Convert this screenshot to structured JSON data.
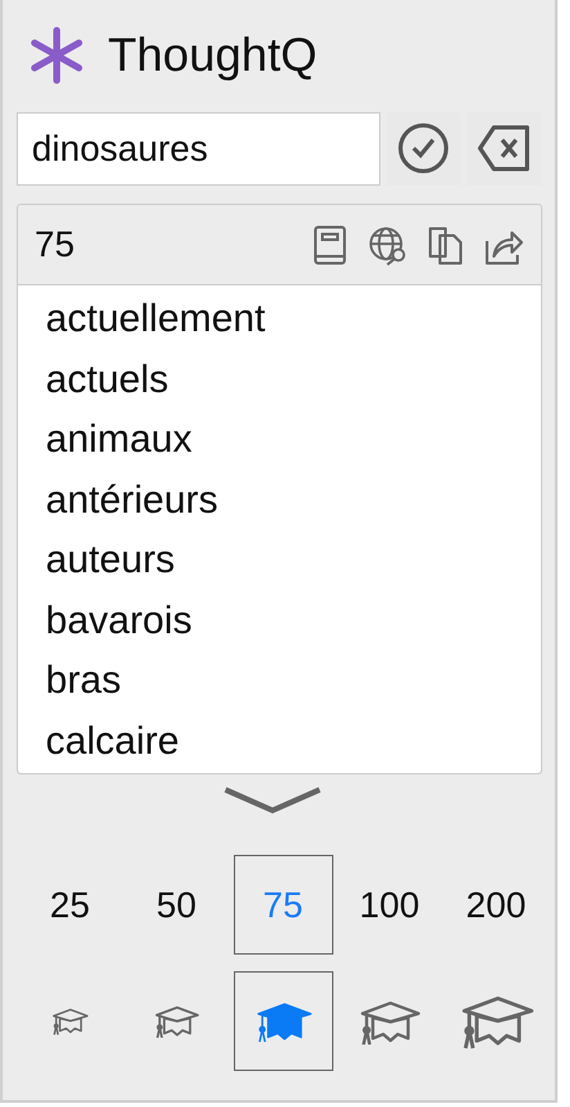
{
  "app": {
    "title": "ThoughtQ"
  },
  "search": {
    "value": "dinosaures"
  },
  "results": {
    "count": "75",
    "words": [
      "actuellement",
      "actuels",
      "animaux",
      "antérieurs",
      "auteurs",
      "bavarois",
      "bras",
      "calcaire"
    ]
  },
  "levels": [
    {
      "label": "25",
      "selected": false
    },
    {
      "label": "50",
      "selected": false
    },
    {
      "label": "75",
      "selected": true
    },
    {
      "label": "100",
      "selected": false
    },
    {
      "label": "200",
      "selected": false
    }
  ],
  "hats": [
    {
      "selected": false
    },
    {
      "selected": false
    },
    {
      "selected": true
    },
    {
      "selected": false
    },
    {
      "selected": false
    }
  ]
}
